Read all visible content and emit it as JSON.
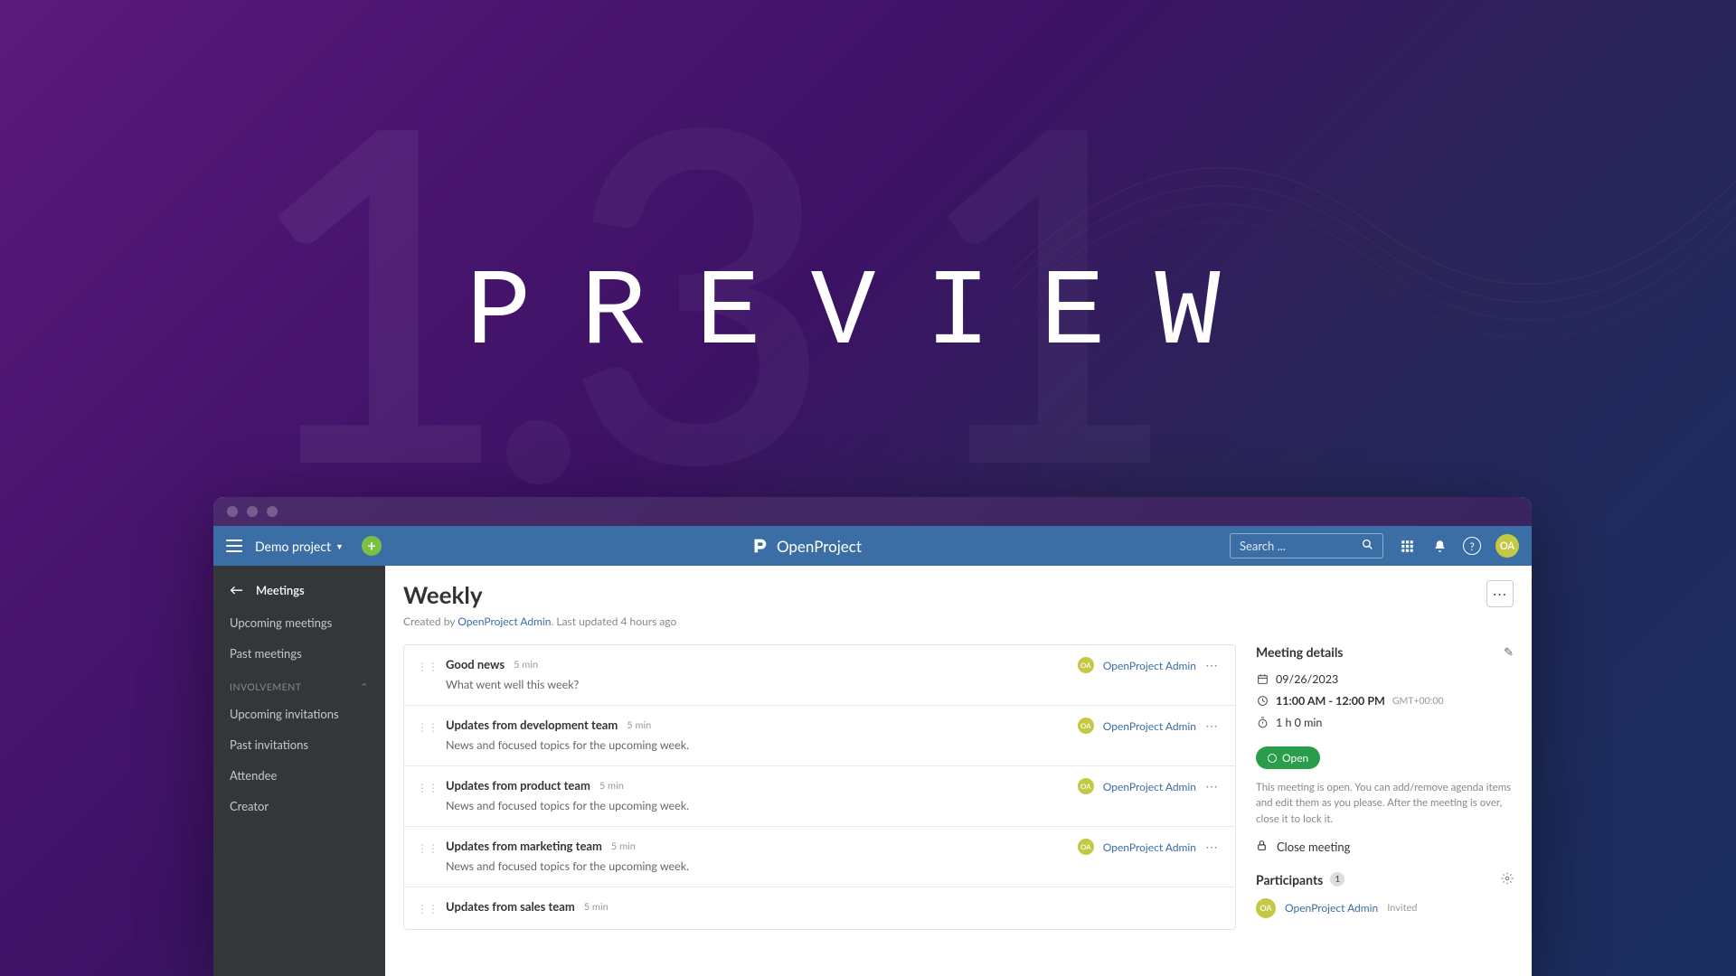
{
  "background": {
    "version_digits": [
      "1",
      "3",
      "1"
    ],
    "headline": "PREVIEW"
  },
  "topbar": {
    "project": "Demo project",
    "brand": "OpenProject",
    "search_placeholder": "Search ...",
    "avatar_initials": "OA"
  },
  "sidebar": {
    "header": "Meetings",
    "items_a": [
      "Upcoming meetings",
      "Past meetings"
    ],
    "section_label": "INVOLVEMENT",
    "items_b": [
      "Upcoming invitations",
      "Past invitations",
      "Attendee",
      "Creator"
    ]
  },
  "page": {
    "title": "Weekly",
    "created_by_prefix": "Created by ",
    "created_by": "OpenProject Admin",
    "meta_suffix": ". Last updated 4 hours ago"
  },
  "agenda": [
    {
      "title": "Good news",
      "duration": "5 min",
      "desc": "What went well this week?",
      "author": "OpenProject Admin"
    },
    {
      "title": "Updates from development team",
      "duration": "5 min",
      "desc": "News and focused topics for the upcoming week.",
      "author": "OpenProject Admin"
    },
    {
      "title": "Updates from product team",
      "duration": "5 min",
      "desc": "News and focused topics for the upcoming week.",
      "author": "OpenProject Admin"
    },
    {
      "title": "Updates from marketing team",
      "duration": "5 min",
      "desc": "News and focused topics for the upcoming week.",
      "author": "OpenProject Admin"
    },
    {
      "title": "Updates from sales team",
      "duration": "5 min",
      "desc": "",
      "author": ""
    }
  ],
  "details": {
    "heading": "Meeting details",
    "date": "09/26/2023",
    "time": "11:00 AM - 12:00 PM",
    "timezone": "GMT+00:00",
    "duration": "1 h 0 min",
    "status": "Open",
    "info": "This meeting is open. You can add/remove agenda items and edit them as you please. After the meeting is over, close it to lock it.",
    "close_label": "Close meeting"
  },
  "participants": {
    "heading": "Participants",
    "count": "1",
    "list": [
      {
        "name": "OpenProject Admin",
        "status": "Invited",
        "initials": "OA"
      }
    ]
  }
}
